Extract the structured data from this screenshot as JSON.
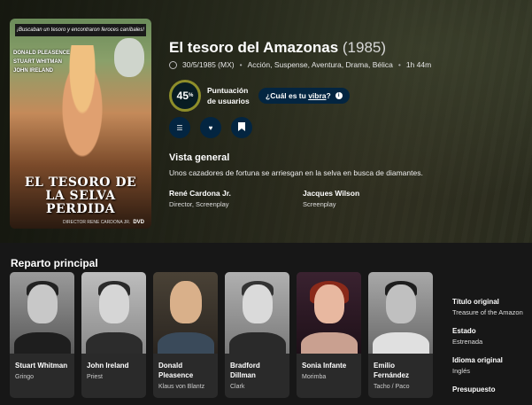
{
  "movie": {
    "title": "El tesoro del Amazonas",
    "year": "(1985)",
    "release": "30/5/1985 (MX)",
    "genres": "Acción, Suspense, Aventura, Drama, Bélica",
    "runtime": "1h 44m",
    "score_value": "45",
    "score_unit": "%",
    "score_label": "Puntuación de usuarios",
    "vibe_prefix": "¿Cuál es tu ",
    "vibe_word": "vibra",
    "vibe_suffix": "?",
    "overview_heading": "Vista general",
    "overview": "Unos cazadores de fortuna se arriesgan en la selva en busca de diamantes.",
    "crew": [
      {
        "name": "René Cardona Jr.",
        "role": "Director, Screenplay"
      },
      {
        "name": "Jacques Wilson",
        "role": "Screenplay"
      }
    ]
  },
  "poster": {
    "banner": "¡Buscaban un tesoro y encontraron feroces caníbales!",
    "cast_line1": "DONALD PLEASENCE",
    "cast_line2": "STUART WHITMAN",
    "cast_line3": "JOHN IRELAND",
    "title": "EL TESORO DE LA SELVA PERDIDA",
    "director": "DIRECTOR RENE CARDONA JR.",
    "dvd": "DVD"
  },
  "cast_heading": "Reparto principal",
  "cast": [
    {
      "name": "Stuart Whitman",
      "character": "Gringo"
    },
    {
      "name": "John Ireland",
      "character": "Priest"
    },
    {
      "name": "Donald Pleasence",
      "character": "Klaus von Blantz"
    },
    {
      "name": "Bradford Dillman",
      "character": "Clark"
    },
    {
      "name": "Sonia Infante",
      "character": "Morimba"
    },
    {
      "name": "Emilio Fernández",
      "character": "Tacho / Paco"
    }
  ],
  "facts": [
    {
      "label": "Título original",
      "value": "Treasure of the Amazon"
    },
    {
      "label": "Estado",
      "value": "Estrenada"
    },
    {
      "label": "Idioma original",
      "value": "Inglés"
    },
    {
      "label": "Presupuesto",
      "value": ""
    }
  ],
  "icons": {
    "list": "list-icon",
    "favorite": "heart-icon",
    "watchlist": "bookmark-icon",
    "info": "info-icon"
  }
}
